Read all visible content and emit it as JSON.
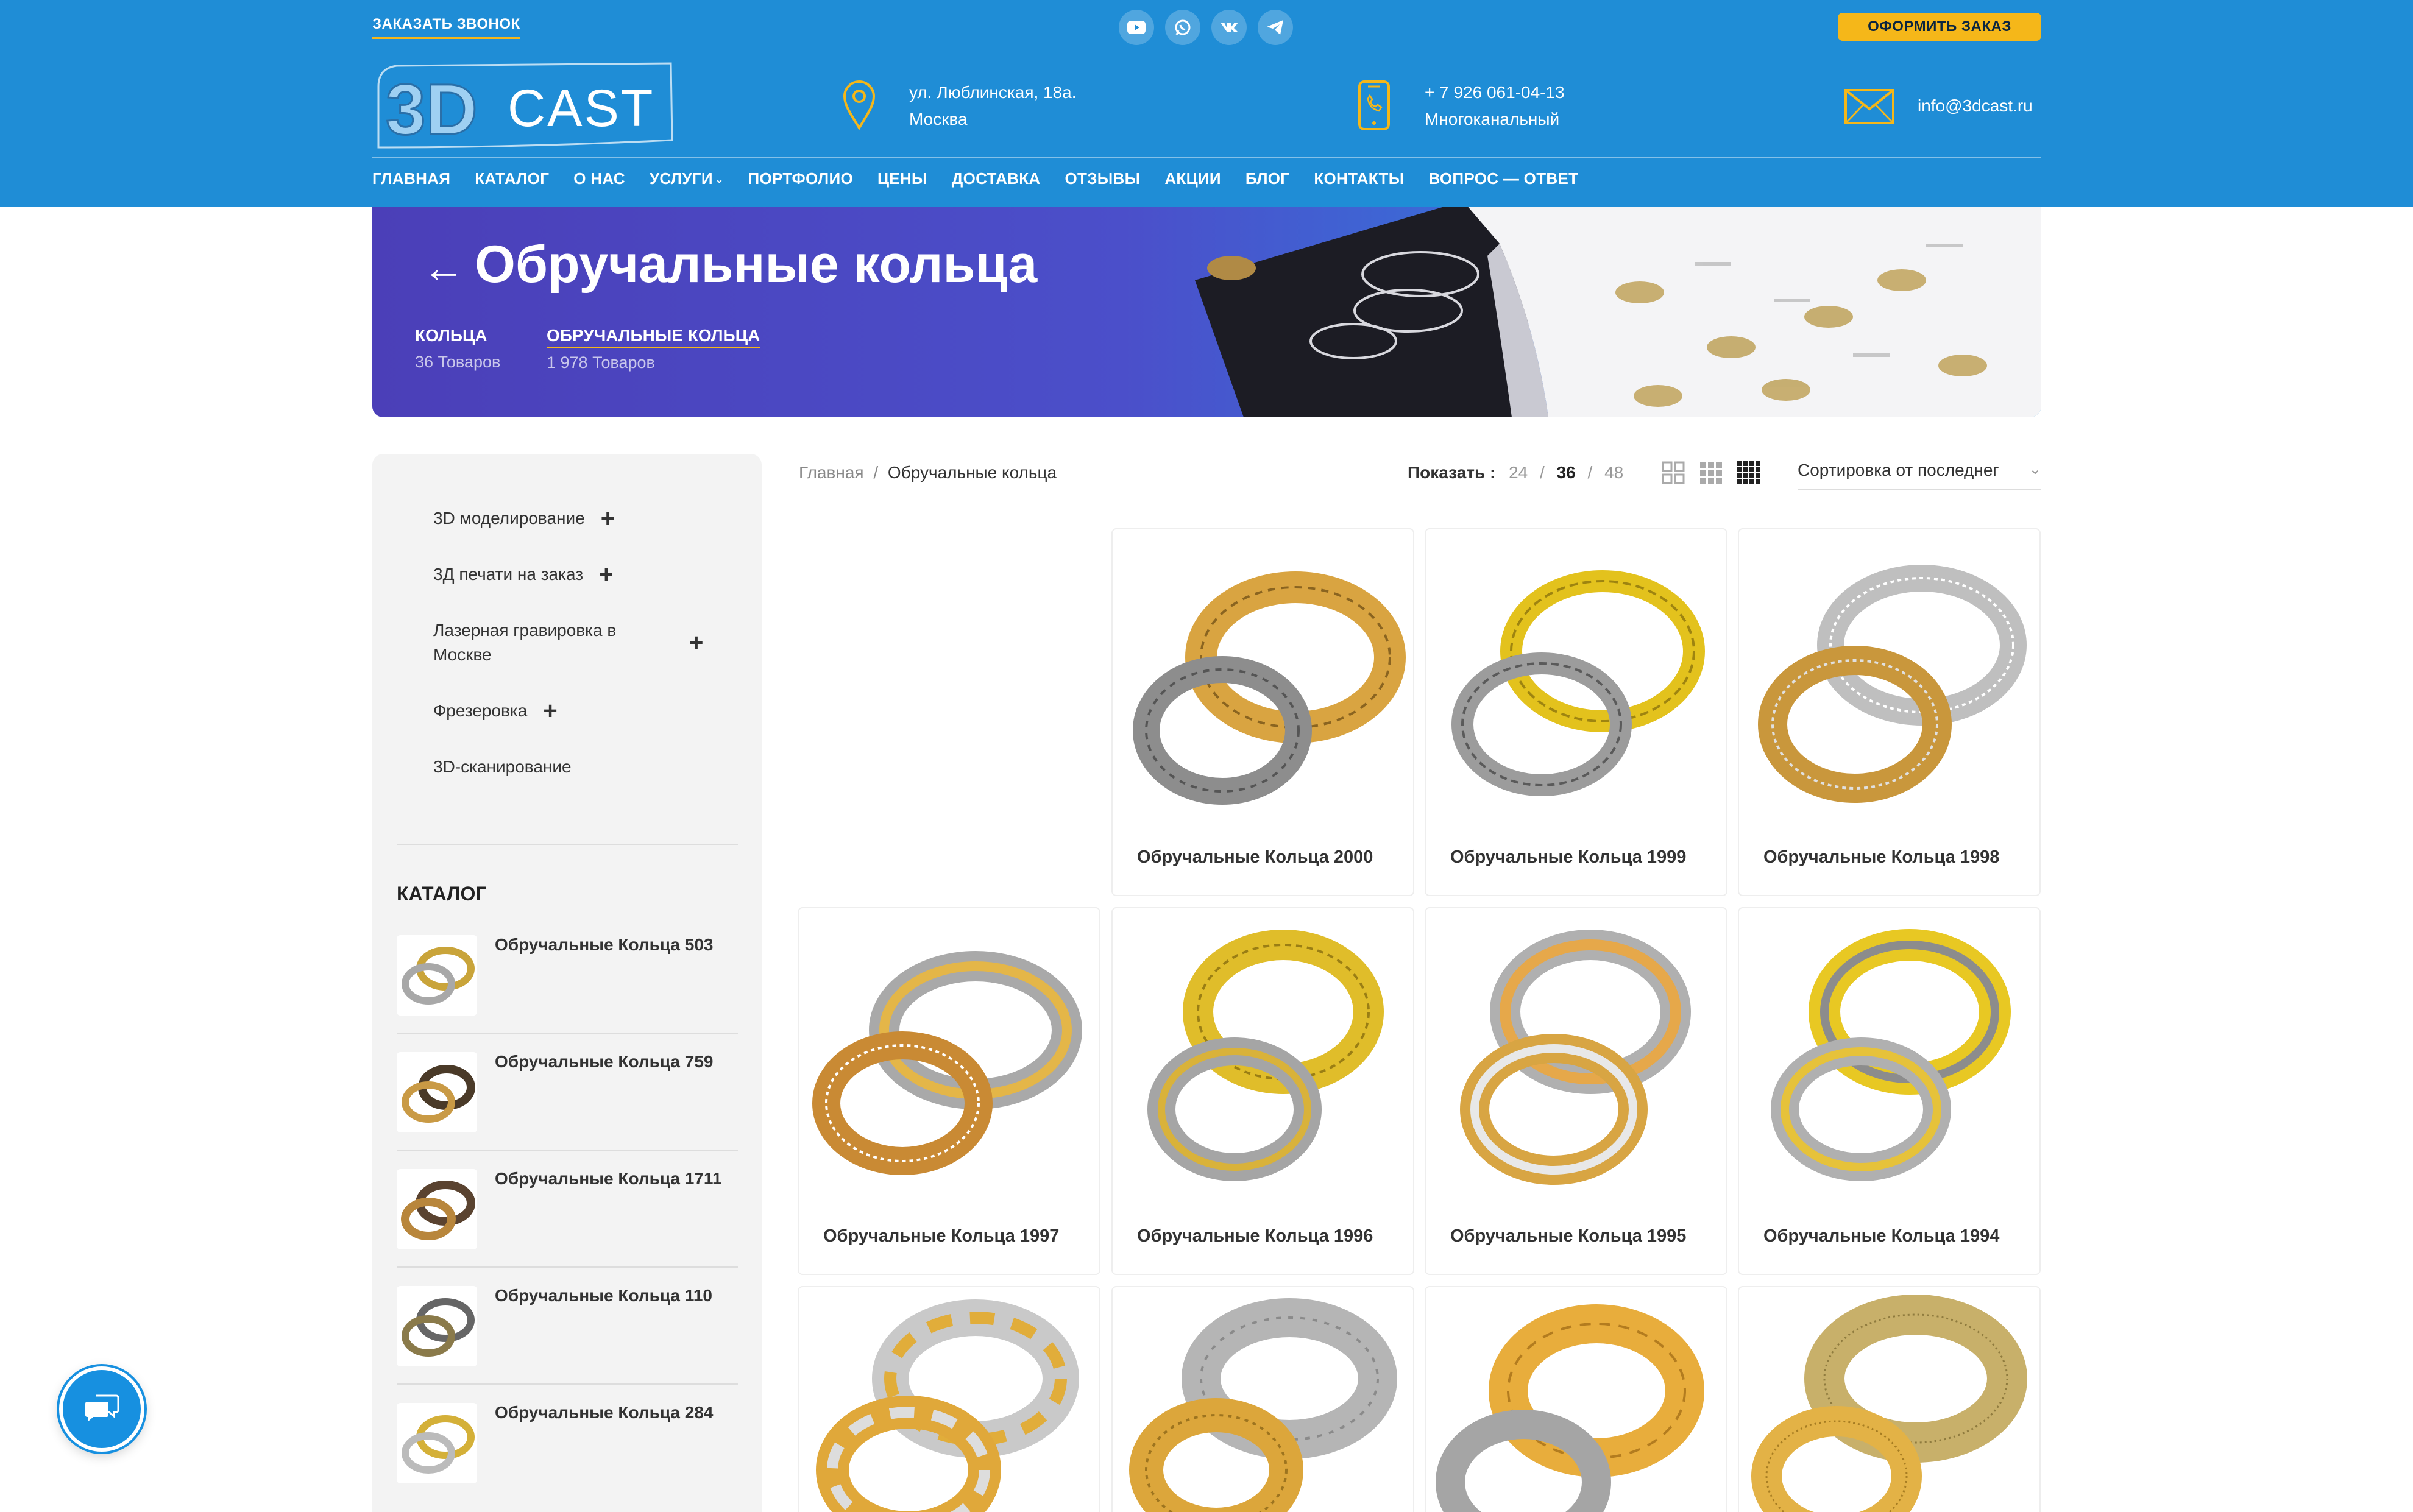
{
  "topbar": {
    "callback_label": "ЗАКАЗАТЬ ЗВОНОК",
    "socials": [
      "youtube-icon",
      "whatsapp-icon",
      "vk-icon",
      "telegram-icon"
    ],
    "order_label": "ОФОРМИТЬ ЗАКАЗ"
  },
  "brand": {
    "logo_3d": "3D",
    "logo_cast": "CAST",
    "accent": "#f5b719",
    "header_bg": "#1f8dd6"
  },
  "contacts": {
    "address_line1": "ул. Люблинская, 18а.",
    "address_line2": "Москва",
    "phone": "+ 7 926 061-04-13",
    "phone_note": "Многоканальный",
    "email": "info@3dcast.ru"
  },
  "nav": [
    "ГЛАВНАЯ",
    "КАТАЛОГ",
    "О НАС",
    "УСЛУГИ",
    "ПОРТФОЛИО",
    "ЦЕНЫ",
    "ДОСТАВКА",
    "ОТЗЫВЫ",
    "АКЦИИ",
    "БЛОГ",
    "КОНТАКТЫ",
    "ВОПРОС — ОТВЕТ"
  ],
  "hero": {
    "back_arrow": "←",
    "title": "Обручальные кольца",
    "categories": [
      {
        "name": "КОЛЬЦА",
        "count": "36 Товаров"
      },
      {
        "name": "ОБРУЧАЛЬНЫЕ КОЛЬЦА",
        "count": "1 978 Товаров"
      }
    ]
  },
  "sidebar": {
    "services": [
      {
        "label": "3D моделирование",
        "expandable": true
      },
      {
        "label": "3Д печати на заказ",
        "expandable": true
      },
      {
        "label_line1": "Лазерная гравировка в",
        "label_line2": "Москве",
        "expandable": true
      },
      {
        "label": "Фрезеровка",
        "expandable": true
      },
      {
        "label": "3D-сканирование",
        "expandable": false
      }
    ],
    "plus": "+",
    "catalog_title": "КАТАЛОГ",
    "catalog_items": [
      "Обручальные Кольца 503",
      "Обручальные Кольца 759",
      "Обручальные Кольца 1711",
      "Обручальные Кольца 110",
      "Обручальные Кольца 284"
    ]
  },
  "breadcrumb": {
    "home": "Главная",
    "sep": "/",
    "current": "Обручальные кольца"
  },
  "toolbar": {
    "show_label": "Показать :",
    "per_page": [
      "24",
      "36",
      "48"
    ],
    "per_page_selected": "36",
    "sep": "/",
    "sort_label": "Сортировка от последнег"
  },
  "products": [
    "Обручальные Кольца 2000",
    "Обручальные Кольца 1999",
    "Обручальные Кольца 1998",
    "Обручальные Кольца 1997",
    "Обручальные Кольца 1996",
    "Обручальные Кольца 1995",
    "Обручальные Кольца 1994",
    "",
    "",
    "",
    ""
  ]
}
